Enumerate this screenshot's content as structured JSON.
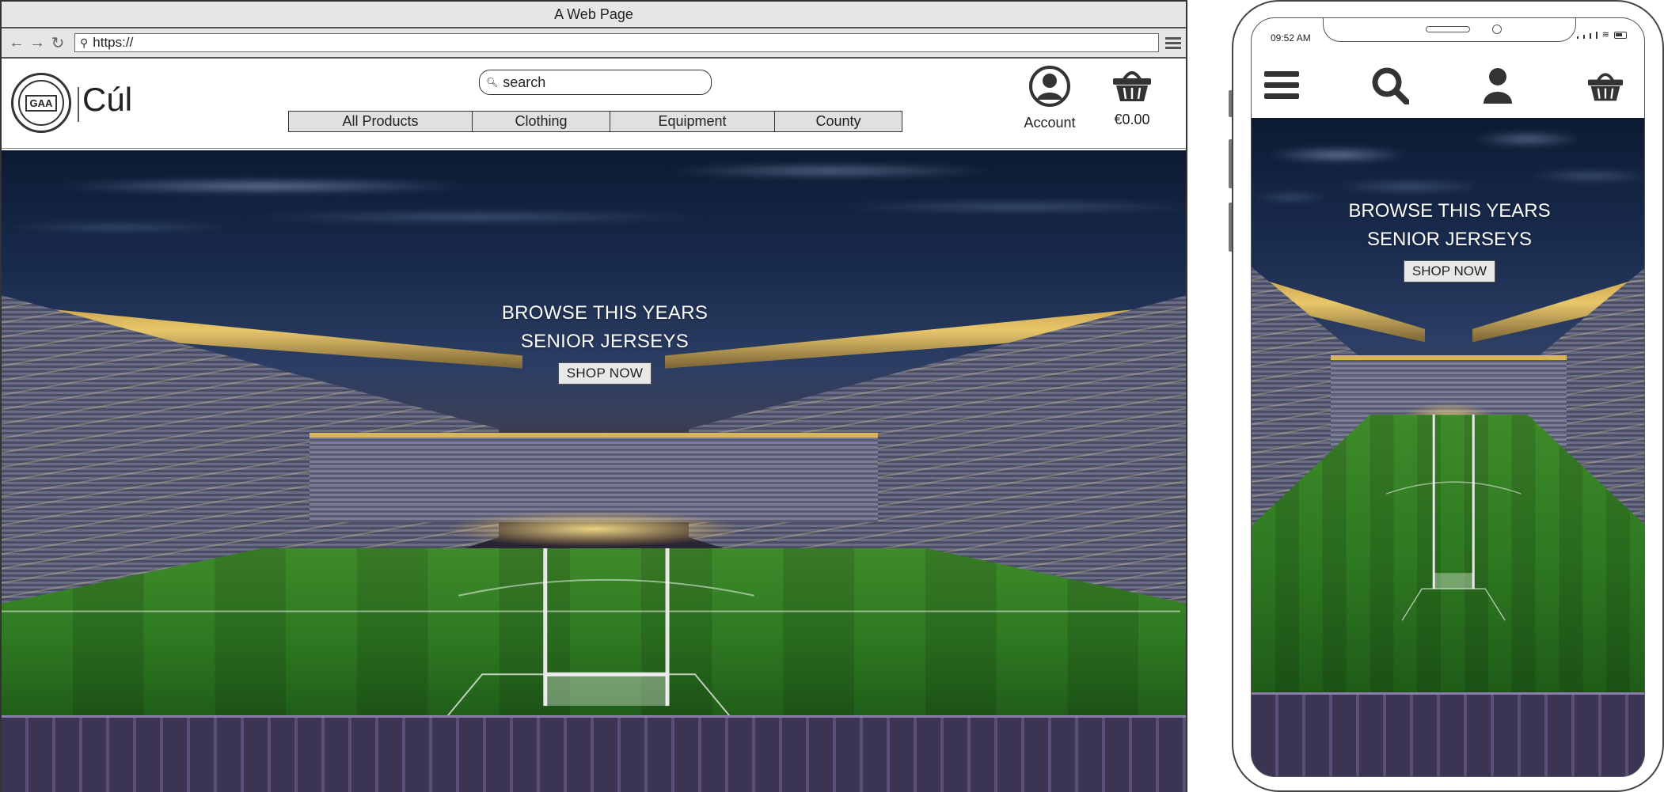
{
  "browser": {
    "window_title": "A Web Page",
    "url": "https://"
  },
  "site": {
    "brand": "Cúl",
    "logo_text": "GAA",
    "search_placeholder": "search",
    "nav": [
      "All Products",
      "Clothing",
      "Equipment",
      "County"
    ],
    "account_label": "Account",
    "cart_total": "€0.00"
  },
  "hero": {
    "line1": "BROWSE THIS YEARS",
    "line2": "SENIOR JERSEYS",
    "cta": "SHOP NOW"
  },
  "phone": {
    "status_time": "09:52 AM",
    "icons": [
      "menu-icon",
      "search-icon",
      "account-icon",
      "cart-icon"
    ]
  },
  "colors": {
    "nav_background": "#e0e0e0",
    "chrome_background": "#e6e6e6",
    "hero_text": "#ffffff"
  }
}
